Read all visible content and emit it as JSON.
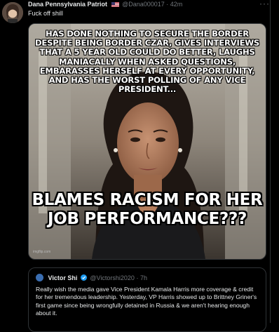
{
  "post": {
    "author_name": "Dana Pennsylvania Patriot",
    "handle": "@Dana000017",
    "separator": "·",
    "time": "42m",
    "text": "Fuck off shill",
    "more_icon": "more-horizontal-icon",
    "flag_icon": "us-flag-icon"
  },
  "meme": {
    "top_caption": "HAS DONE NOTHING TO SECURE THE BORDER DESPITE BEING BORDER CZAR, GIVES INTERVIEWS THAT A 5 YEAR OLD COULD DO BETTER, LAUGHS MANIACALLY WHEN ASKED QUESTIONS, EMBARASSES HERSELF AT EVERY OPPORTUNITY, AND HAS THE WORST POLLING OF ANY VICE PRESIDENT...",
    "bottom_caption": "BLAMES RACISM FOR HER JOB PERFORMANCE???",
    "watermark": "imgflip.com"
  },
  "quoted": {
    "author_name": "Victor Shi",
    "handle": "@Victorshi2020",
    "separator": "·",
    "time": "7h",
    "text": "Really wish the media gave Vice President Kamala Harris more coverage & credit for her tremendous leadership. Yesterday, VP Harris showed up to Brittney Griner's first game since being wrongfully detained in Russia & we aren't hearing enough about it.",
    "verified_icon": "verified-badge-icon"
  },
  "colors": {
    "background": "#000000",
    "text_primary": "#e7e9ea",
    "text_secondary": "#71767b",
    "border": "#2f3336",
    "verified": "#1d9bf0"
  }
}
